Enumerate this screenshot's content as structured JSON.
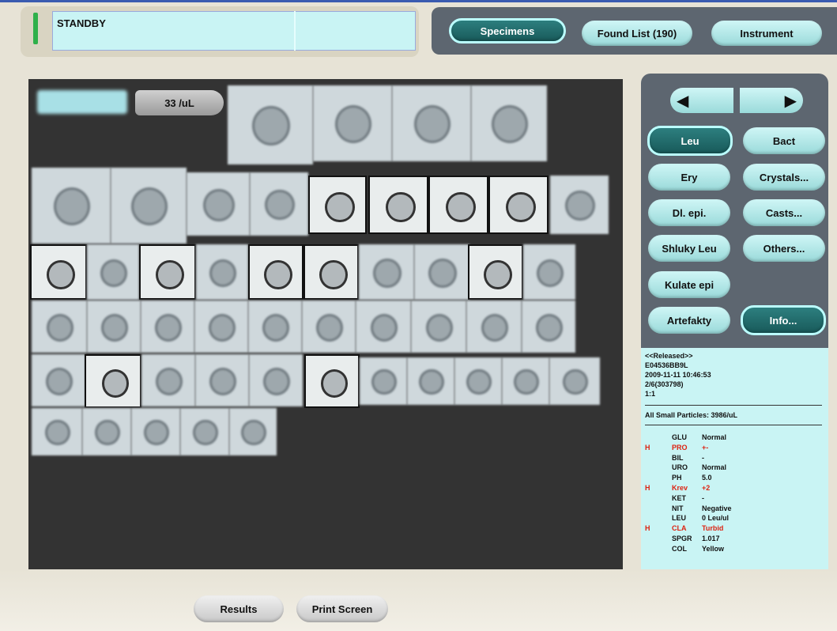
{
  "status": {
    "text": "STANDBY"
  },
  "topnav": {
    "specimens": "Specimens",
    "found_list": "Found List (190)",
    "instrument": "Instrument"
  },
  "gallery": {
    "concentration": "33 /uL"
  },
  "categories": [
    "Leu",
    "Bact",
    "Ery",
    "Crystals...",
    "Dl. epi.",
    "Casts...",
    "Shluky Leu",
    "Others...",
    "Kulate epi",
    "Artefakty",
    "Info..."
  ],
  "info": {
    "released": "<<Released>>",
    "sample_id": "E04536BB9L",
    "datetime": "2009-11-11 10:46:53",
    "position": "2/6(303798)",
    "dilution": "1:1",
    "small_particles": "All Small Particles: 3986/uL"
  },
  "urinalysis": [
    {
      "flag": "",
      "name": "GLU",
      "value": "Normal"
    },
    {
      "flag": "H",
      "name": "PRO",
      "value": "+-"
    },
    {
      "flag": "",
      "name": "BIL",
      "value": "-"
    },
    {
      "flag": "",
      "name": "URO",
      "value": "Normal"
    },
    {
      "flag": "",
      "name": "PH",
      "value": "5.0"
    },
    {
      "flag": "H",
      "name": "Krev",
      "value": "+2"
    },
    {
      "flag": "",
      "name": "KET",
      "value": "-"
    },
    {
      "flag": "",
      "name": "NIT",
      "value": "Negative"
    },
    {
      "flag": "",
      "name": "LEU",
      "value": "0 Leu/ul"
    },
    {
      "flag": "H",
      "name": "CLA",
      "value": "Turbid"
    },
    {
      "flag": "",
      "name": "SPGR",
      "value": "1.017"
    },
    {
      "flag": "",
      "name": "COL",
      "value": "Yellow"
    }
  ],
  "bottom": {
    "results": "Results",
    "print_screen": "Print Screen"
  }
}
